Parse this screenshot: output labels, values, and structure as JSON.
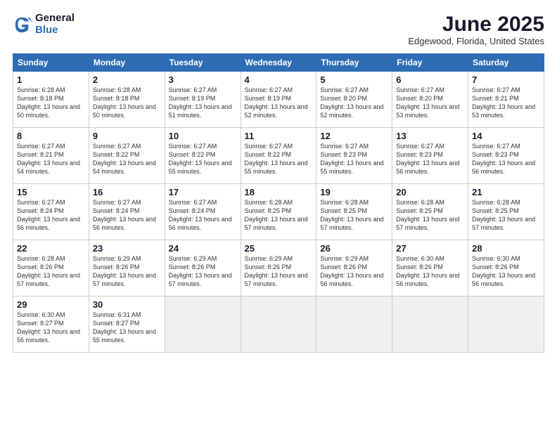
{
  "logo": {
    "general": "General",
    "blue": "Blue"
  },
  "title": "June 2025",
  "location": "Edgewood, Florida, United States",
  "days_of_week": [
    "Sunday",
    "Monday",
    "Tuesday",
    "Wednesday",
    "Thursday",
    "Friday",
    "Saturday"
  ],
  "weeks": [
    [
      {
        "num": "1",
        "sunrise": "6:28 AM",
        "sunset": "8:18 PM",
        "daylight": "13 hours and 50 minutes."
      },
      {
        "num": "2",
        "sunrise": "6:28 AM",
        "sunset": "8:18 PM",
        "daylight": "13 hours and 50 minutes."
      },
      {
        "num": "3",
        "sunrise": "6:27 AM",
        "sunset": "8:19 PM",
        "daylight": "13 hours and 51 minutes."
      },
      {
        "num": "4",
        "sunrise": "6:27 AM",
        "sunset": "8:19 PM",
        "daylight": "13 hours and 52 minutes."
      },
      {
        "num": "5",
        "sunrise": "6:27 AM",
        "sunset": "8:20 PM",
        "daylight": "13 hours and 52 minutes."
      },
      {
        "num": "6",
        "sunrise": "6:27 AM",
        "sunset": "8:20 PM",
        "daylight": "13 hours and 53 minutes."
      },
      {
        "num": "7",
        "sunrise": "6:27 AM",
        "sunset": "8:21 PM",
        "daylight": "13 hours and 53 minutes."
      }
    ],
    [
      {
        "num": "8",
        "sunrise": "6:27 AM",
        "sunset": "8:21 PM",
        "daylight": "13 hours and 54 minutes."
      },
      {
        "num": "9",
        "sunrise": "6:27 AM",
        "sunset": "8:22 PM",
        "daylight": "13 hours and 54 minutes."
      },
      {
        "num": "10",
        "sunrise": "6:27 AM",
        "sunset": "8:22 PM",
        "daylight": "13 hours and 55 minutes."
      },
      {
        "num": "11",
        "sunrise": "6:27 AM",
        "sunset": "8:22 PM",
        "daylight": "13 hours and 55 minutes."
      },
      {
        "num": "12",
        "sunrise": "6:27 AM",
        "sunset": "8:23 PM",
        "daylight": "13 hours and 55 minutes."
      },
      {
        "num": "13",
        "sunrise": "6:27 AM",
        "sunset": "8:23 PM",
        "daylight": "13 hours and 56 minutes."
      },
      {
        "num": "14",
        "sunrise": "6:27 AM",
        "sunset": "8:23 PM",
        "daylight": "13 hours and 56 minutes."
      }
    ],
    [
      {
        "num": "15",
        "sunrise": "6:27 AM",
        "sunset": "8:24 PM",
        "daylight": "13 hours and 56 minutes."
      },
      {
        "num": "16",
        "sunrise": "6:27 AM",
        "sunset": "8:24 PM",
        "daylight": "13 hours and 56 minutes."
      },
      {
        "num": "17",
        "sunrise": "6:27 AM",
        "sunset": "8:24 PM",
        "daylight": "13 hours and 56 minutes."
      },
      {
        "num": "18",
        "sunrise": "6:28 AM",
        "sunset": "8:25 PM",
        "daylight": "13 hours and 57 minutes."
      },
      {
        "num": "19",
        "sunrise": "6:28 AM",
        "sunset": "8:25 PM",
        "daylight": "13 hours and 57 minutes."
      },
      {
        "num": "20",
        "sunrise": "6:28 AM",
        "sunset": "8:25 PM",
        "daylight": "13 hours and 57 minutes."
      },
      {
        "num": "21",
        "sunrise": "6:28 AM",
        "sunset": "8:25 PM",
        "daylight": "13 hours and 57 minutes."
      }
    ],
    [
      {
        "num": "22",
        "sunrise": "6:28 AM",
        "sunset": "8:26 PM",
        "daylight": "13 hours and 57 minutes."
      },
      {
        "num": "23",
        "sunrise": "6:29 AM",
        "sunset": "8:26 PM",
        "daylight": "13 hours and 57 minutes."
      },
      {
        "num": "24",
        "sunrise": "6:29 AM",
        "sunset": "8:26 PM",
        "daylight": "13 hours and 57 minutes."
      },
      {
        "num": "25",
        "sunrise": "6:29 AM",
        "sunset": "8:26 PM",
        "daylight": "13 hours and 57 minutes."
      },
      {
        "num": "26",
        "sunrise": "6:29 AM",
        "sunset": "8:26 PM",
        "daylight": "13 hours and 56 minutes."
      },
      {
        "num": "27",
        "sunrise": "6:30 AM",
        "sunset": "8:26 PM",
        "daylight": "13 hours and 56 minutes."
      },
      {
        "num": "28",
        "sunrise": "6:30 AM",
        "sunset": "8:26 PM",
        "daylight": "13 hours and 56 minutes."
      }
    ],
    [
      {
        "num": "29",
        "sunrise": "6:30 AM",
        "sunset": "8:27 PM",
        "daylight": "13 hours and 56 minutes."
      },
      {
        "num": "30",
        "sunrise": "6:31 AM",
        "sunset": "8:27 PM",
        "daylight": "13 hours and 55 minutes."
      },
      null,
      null,
      null,
      null,
      null
    ]
  ]
}
